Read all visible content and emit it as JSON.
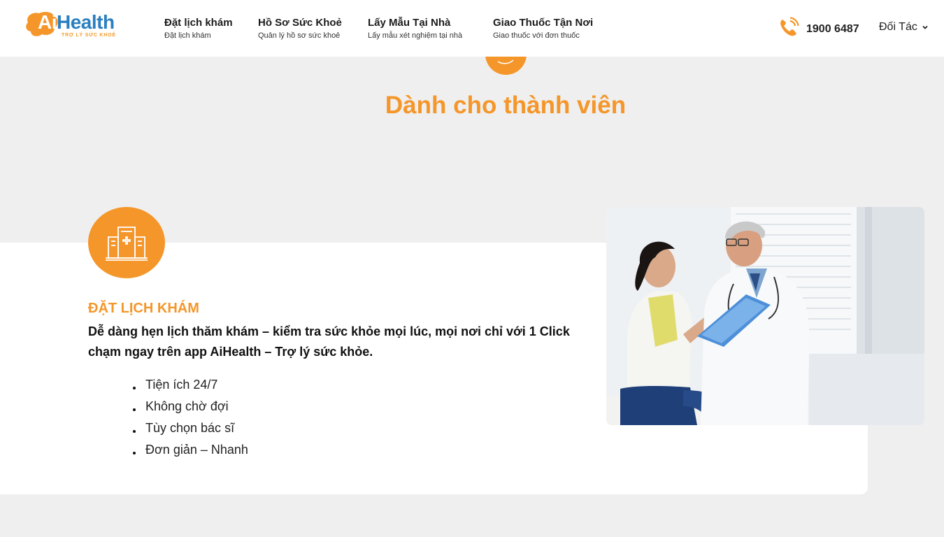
{
  "logo": {
    "ai": "Ai",
    "health": "Health",
    "tagline": "TRỢ LÝ SỨC KHOẺ"
  },
  "nav": [
    {
      "title": "Đặt lịch khám",
      "subtitle": "Đặt lịch khám"
    },
    {
      "title": "Hồ Sơ Sức Khoẻ",
      "subtitle": "Quản lý hồ sơ sức khoẻ"
    },
    {
      "title": "Lấy Mẫu Tại Nhà",
      "subtitle": "Lấy mẫu xét nghiệm tại nhà"
    },
    {
      "title": "Giao Thuốc Tận Nơi",
      "subtitle": "Giao thuốc với đơn thuốc"
    }
  ],
  "phone": "1900 6487",
  "partner": {
    "label": "Đối Tác"
  },
  "section": {
    "title": "Dành cho thành viên"
  },
  "service": {
    "heading": "ĐẶT LỊCH KHÁM",
    "description": "Dễ dàng hẹn lịch thăm khám – kiểm tra sức khỏe mọi lúc, mọi nơi chỉ với 1 Click chạm ngay trên app AiHealth – Trợ lý sức khỏe.",
    "features": [
      "Tiện ích 24/7",
      "Không chờ đợi",
      "Tùy chọn bác sĩ",
      "Đơn giản – Nhanh"
    ]
  },
  "colors": {
    "accent": "#f5962a",
    "brand_blue": "#2a7fc0",
    "background": "#efefef"
  }
}
